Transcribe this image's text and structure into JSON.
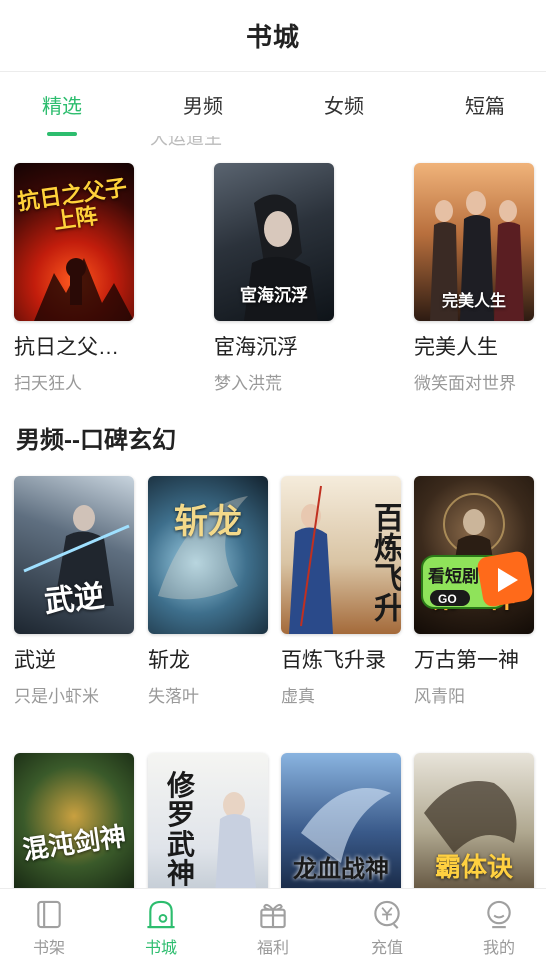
{
  "header": {
    "title": "书城"
  },
  "tabs": [
    {
      "label": "精选",
      "active": true
    },
    {
      "label": "男频",
      "active": false
    },
    {
      "label": "女频",
      "active": false
    },
    {
      "label": "短篇",
      "active": false
    }
  ],
  "peek": {
    "text": "大运道生"
  },
  "row1": [
    {
      "title": "抗日之父…",
      "author": "扫天狂人",
      "cover_text": "抗日之父子上阵"
    },
    {
      "title": "宦海沉浮",
      "author": "梦入洪荒",
      "cover_text": "宦海沉浮"
    },
    {
      "title": "完美人生",
      "author": "微笑面对世界",
      "cover_text": "完美人生"
    }
  ],
  "section2": {
    "title": "男频--口碑玄幻"
  },
  "row2": [
    {
      "title": "武逆",
      "author": "只是小虾米",
      "cover_text": "武逆"
    },
    {
      "title": "斩龙",
      "author": "失落叶",
      "cover_text": "斩龙"
    },
    {
      "title": "百炼飞升录",
      "author": "虚真",
      "cover_text": "百炼飞升"
    },
    {
      "title": "万古第一神",
      "author": "风青阳",
      "cover_text": "第一神"
    }
  ],
  "row3": [
    {
      "cover_text": "混沌剑神"
    },
    {
      "cover_text": "修罗武神"
    },
    {
      "cover_text": "龙血战神"
    },
    {
      "cover_text": "霸体诀"
    }
  ],
  "promo": {
    "line1": "看短剧",
    "line2": "GO"
  },
  "bottom_nav": [
    {
      "label": "书架",
      "icon": "bookshelf-icon",
      "active": false
    },
    {
      "label": "书城",
      "icon": "bookstore-icon",
      "active": true
    },
    {
      "label": "福利",
      "icon": "gift-icon",
      "active": false
    },
    {
      "label": "充值",
      "icon": "recharge-icon",
      "active": false
    },
    {
      "label": "我的",
      "icon": "profile-icon",
      "active": false
    }
  ],
  "colors": {
    "accent": "#2dbd6e",
    "text": "#222222",
    "muted": "#999999"
  }
}
